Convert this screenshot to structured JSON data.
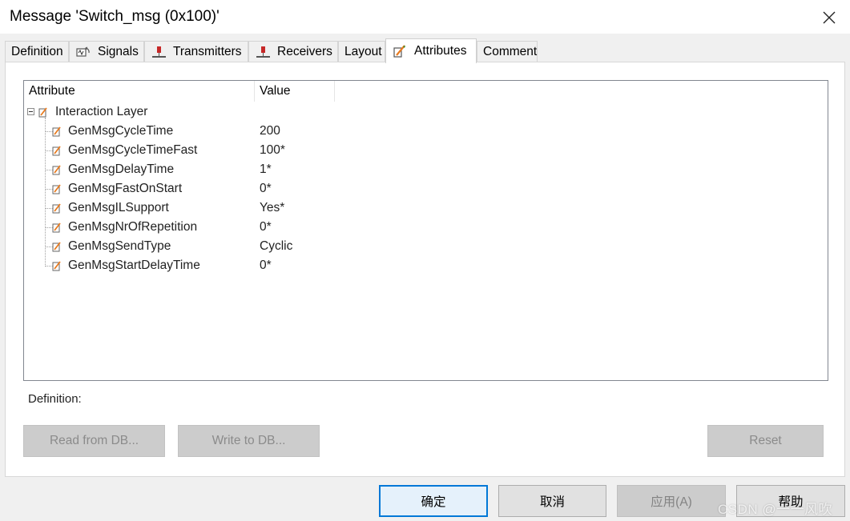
{
  "window": {
    "title": "Message 'Switch_msg (0x100)'"
  },
  "tabs": [
    {
      "label": "Definition",
      "icon": null,
      "active": false
    },
    {
      "label": "Signals",
      "icon": "signals-icon",
      "active": false
    },
    {
      "label": "Transmitters",
      "icon": "transmitter-icon",
      "active": false
    },
    {
      "label": "Receivers",
      "icon": "receiver-icon",
      "active": false
    },
    {
      "label": "Layout",
      "icon": null,
      "active": false
    },
    {
      "label": "Attributes",
      "icon": "attributes-icon",
      "active": true
    },
    {
      "label": "Comment",
      "icon": null,
      "active": false
    }
  ],
  "attributes": {
    "columns": {
      "attribute": "Attribute",
      "value": "Value"
    },
    "group": {
      "label": "Interaction Layer",
      "expanded": true
    },
    "rows": [
      {
        "name": "GenMsgCycleTime",
        "value": "200"
      },
      {
        "name": "GenMsgCycleTimeFast",
        "value": "100*"
      },
      {
        "name": "GenMsgDelayTime",
        "value": "1*"
      },
      {
        "name": "GenMsgFastOnStart",
        "value": "0*"
      },
      {
        "name": "GenMsgILSupport",
        "value": "Yes*"
      },
      {
        "name": "GenMsgNrOfRepetition",
        "value": "0*"
      },
      {
        "name": "GenMsgSendType",
        "value": "Cyclic"
      },
      {
        "name": "GenMsgStartDelayTime",
        "value": "0*"
      }
    ]
  },
  "definition_label": "Definition:",
  "panel_buttons": {
    "read_from_db": "Read from DB...",
    "write_to_db": "Write to DB...",
    "reset": "Reset"
  },
  "dialog_buttons": {
    "ok": "确定",
    "cancel": "取消",
    "apply": "应用(A)",
    "help": "帮助"
  },
  "watermark": "CSDN @一一风吹",
  "colors": {
    "focus_border": "#0078d7",
    "pin_red": "#c62828",
    "attr_icon_orange": "#e87a1e"
  }
}
